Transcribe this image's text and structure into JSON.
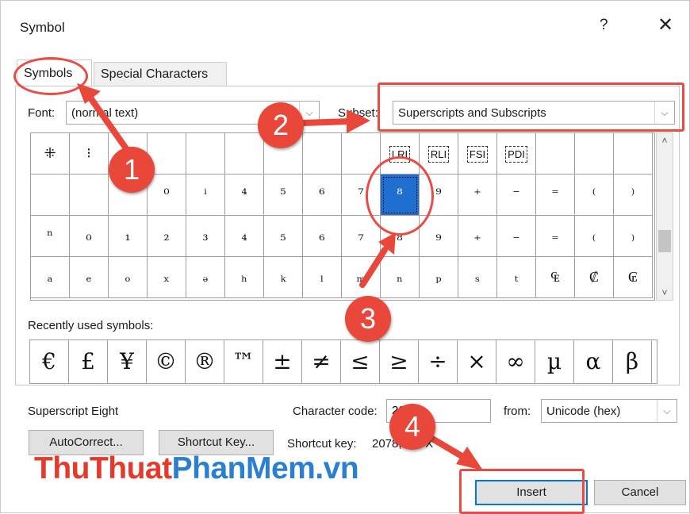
{
  "window": {
    "title": "Symbol",
    "help": "?",
    "close": "✕"
  },
  "tabs": [
    {
      "label": "Symbols",
      "accel": "S"
    },
    {
      "label": "Special Characters",
      "accel": "p"
    }
  ],
  "font": {
    "label": "Font:",
    "value": "(normal text)"
  },
  "subset": {
    "label": "Subset:",
    "value": "Superscripts and Subscripts"
  },
  "grid_rows": [
    [
      "⁜",
      "⁝",
      "",
      "",
      "",
      "",
      "",
      "",
      "",
      "LRI",
      "RLI",
      "FSI",
      "PDI",
      "",
      "",
      ""
    ],
    [
      "",
      "",
      "",
      "⁰",
      "ⁱ",
      "⁴",
      "⁵",
      "⁶",
      "⁷",
      "⁸",
      "⁹",
      "⁺",
      "⁻",
      "⁼",
      "⁽",
      "⁾"
    ],
    [
      "ⁿ",
      "₀",
      "₁",
      "₂",
      "₃",
      "₄",
      "₅",
      "₆",
      "₇",
      "₈",
      "₉",
      "₊",
      "₋",
      "₌",
      "₍",
      "₎"
    ],
    [
      "ₐ",
      "ₑ",
      "ₒ",
      "ₓ",
      "ₔ",
      "ₕ",
      "ₖ",
      "ₗ",
      "ₘ",
      "ₙ",
      "ₚ",
      "ₛ",
      "ₜ",
      "₠",
      "₡",
      "₢"
    ]
  ],
  "selected": {
    "row": 1,
    "col": 9
  },
  "recent": {
    "label": "Recently used symbols:",
    "symbols": [
      "€",
      "£",
      "¥",
      "©",
      "®",
      "™",
      "±",
      "≠",
      "≤",
      "≥",
      "÷",
      "×",
      "∞",
      "µ",
      "α",
      "β"
    ]
  },
  "char_name": "Superscript Eight",
  "char_code": {
    "label": "Character code:",
    "value": "2078"
  },
  "from": {
    "label": "from:",
    "value": "Unicode (hex)"
  },
  "buttons": {
    "autocorrect": "AutoCorrect...",
    "shortcut_key": "Shortcut Key...",
    "insert": "Insert",
    "cancel": "Cancel"
  },
  "shortcut": {
    "label": "Shortcut key:",
    "value": "2078, Alt+X"
  },
  "watermark": {
    "part1": "ThuThuat",
    "part2": "PhanMem",
    "part3": ".vn"
  },
  "annotations": {
    "badges": [
      "1",
      "2",
      "3",
      "4"
    ],
    "color": "#e8473a"
  }
}
